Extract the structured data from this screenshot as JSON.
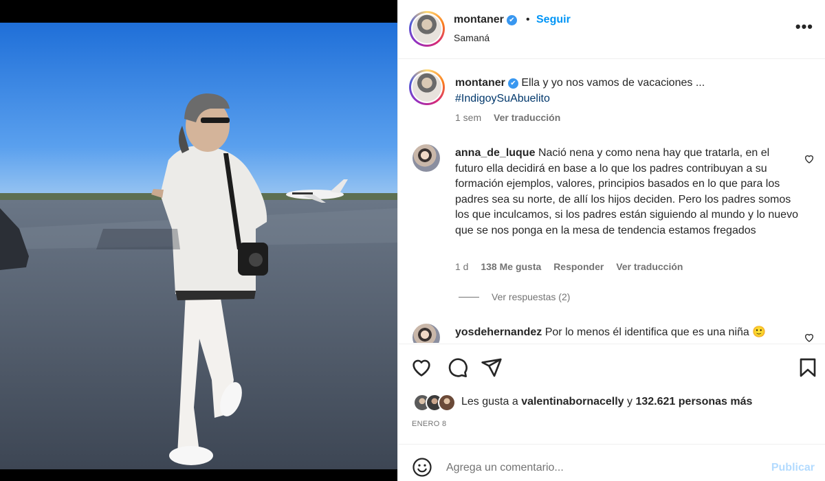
{
  "post": {
    "username": "montaner",
    "verified_mark": "✔",
    "separator": "•",
    "follow_label": "Seguir",
    "location": "Samaná",
    "more_icon": "more-options-icon",
    "more_label": "•••"
  },
  "caption": {
    "username": "montaner",
    "text": "Ella y yo nos vamos de vacaciones ...",
    "hashtag": "#IndigoySuAbuelito",
    "age": "1 sem",
    "translate": "Ver traducción"
  },
  "comments": [
    {
      "username": "anna_de_luque",
      "text": "Nació nena y como nena hay que tratarla, en el futuro ella decidirá en base a lo que los padres contribuyan a su formación ejemplos, valores, principios basados en lo que para los padres sea su norte, de allí los hijos deciden. Pero los padres somos los que inculcamos, si los padres están siguiendo al mundo y lo nuevo que se nos ponga en la mesa de tendencia estamos fregados",
      "age": "1 d",
      "likes": "138 Me gusta",
      "reply": "Responder",
      "translate": "Ver traducción",
      "view_replies": "Ver respuestas (2)"
    },
    {
      "username": "yosdehernandez",
      "text": "Por lo menos él identifica que es una niña 🙂"
    }
  ],
  "actions": {
    "icons": [
      "heart-icon",
      "comment-icon",
      "share-icon",
      "save-icon"
    ],
    "likes_prefix": "Les gusta a",
    "likes_user": "valentinabornacelly",
    "likes_connector": "y",
    "likes_count": "132.621 personas más",
    "date": "ENERO 8"
  },
  "add_comment": {
    "placeholder": "Agrega un comentario...",
    "publish_label": "Publicar"
  },
  "colors": {
    "accent": "#0095f6",
    "publish_disabled": "#b3dbff",
    "text": "#262626",
    "muted": "#737373"
  }
}
